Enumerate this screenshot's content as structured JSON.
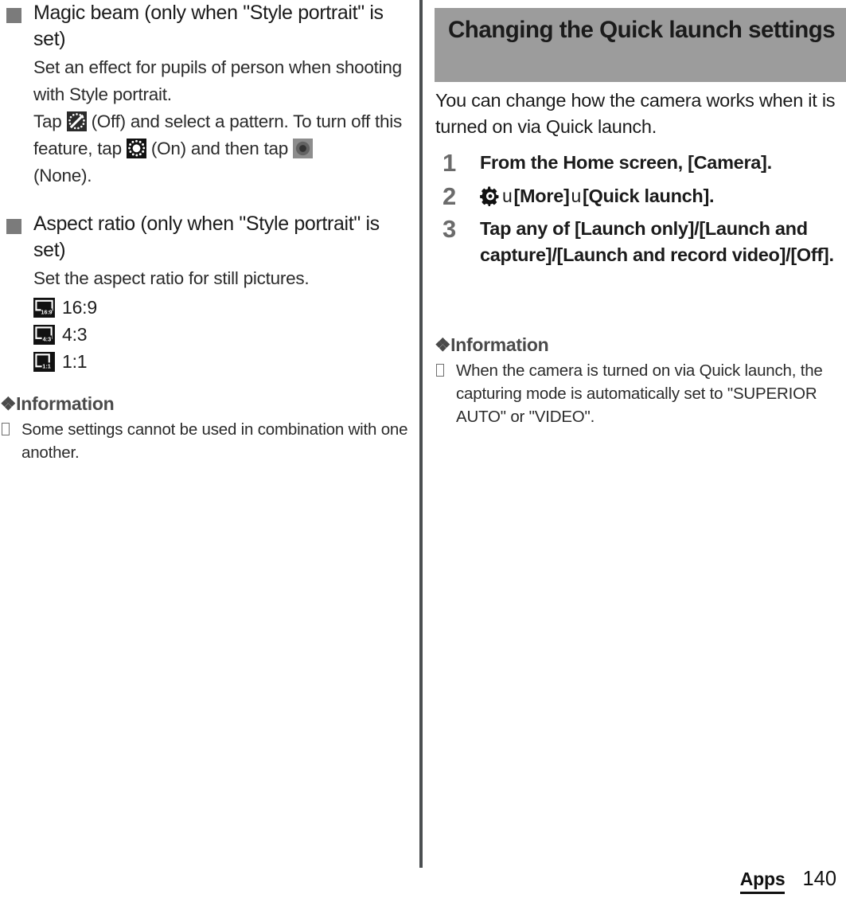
{
  "document": {
    "footer": {
      "chapter_label": "Apps",
      "page_number": "140"
    }
  },
  "left_column": {
    "sections": [
      {
        "bullet": "square-bullet",
        "title": "Magic beam (only when \"Style portrait\" is set)",
        "body_line_1": "Set an effect for pupils of person when shooting with Style portrait.",
        "body_tap_prefix": "Tap",
        "off_label": "(Off) and select a pattern. To turn off this feature, tap",
        "on_label": "(On) and then tap",
        "none_label": "(None)."
      },
      {
        "bullet": "square-bullet",
        "title": "Aspect ratio (only when \"Style portrait\" is set)",
        "body_line_1": "Set the aspect ratio for still pictures.",
        "ratios": [
          {
            "icon": "aspect-ratio-16-9-icon",
            "badge": "16:9",
            "label": "16:9"
          },
          {
            "icon": "aspect-ratio-4-3-icon",
            "badge": "4:3",
            "label": "4:3"
          },
          {
            "icon": "aspect-ratio-1-1-icon",
            "badge": "1:1",
            "label": "1:1"
          }
        ]
      }
    ],
    "information": {
      "heading_diamond": "❖",
      "heading": "Information",
      "items": [
        "Some settings cannot be used in combination with one another."
      ]
    }
  },
  "right_column": {
    "chapter_heading": "Changing the Quick launch settings",
    "intro": "You can change how the camera works when it is turned on via Quick launch.",
    "steps": [
      {
        "number": "1",
        "text_bold": "From the Home screen, [Camera]."
      },
      {
        "number": "2",
        "icon": "settings-gear-icon",
        "arrow": "u",
        "part_1": "[More]",
        "part_2": "[Quick launch]."
      },
      {
        "number": "3",
        "text_bold": "Tap any of [Launch only]/[Launch and capture]/[Launch and record video]/[Off]."
      }
    ],
    "information": {
      "heading_diamond": "❖",
      "heading": "Information",
      "items": [
        "When the camera is turned on via Quick launch, the capturing mode is automatically set to \"SUPERIOR AUTO\" or \"VIDEO\"."
      ]
    }
  },
  "colors": {
    "chapter_band": "#9c9c9c",
    "divider": "#4b4f51",
    "bullet_square": "#7b7b7b",
    "step_number": "#6b6b6b",
    "info_heading": "#4a4a4a"
  }
}
